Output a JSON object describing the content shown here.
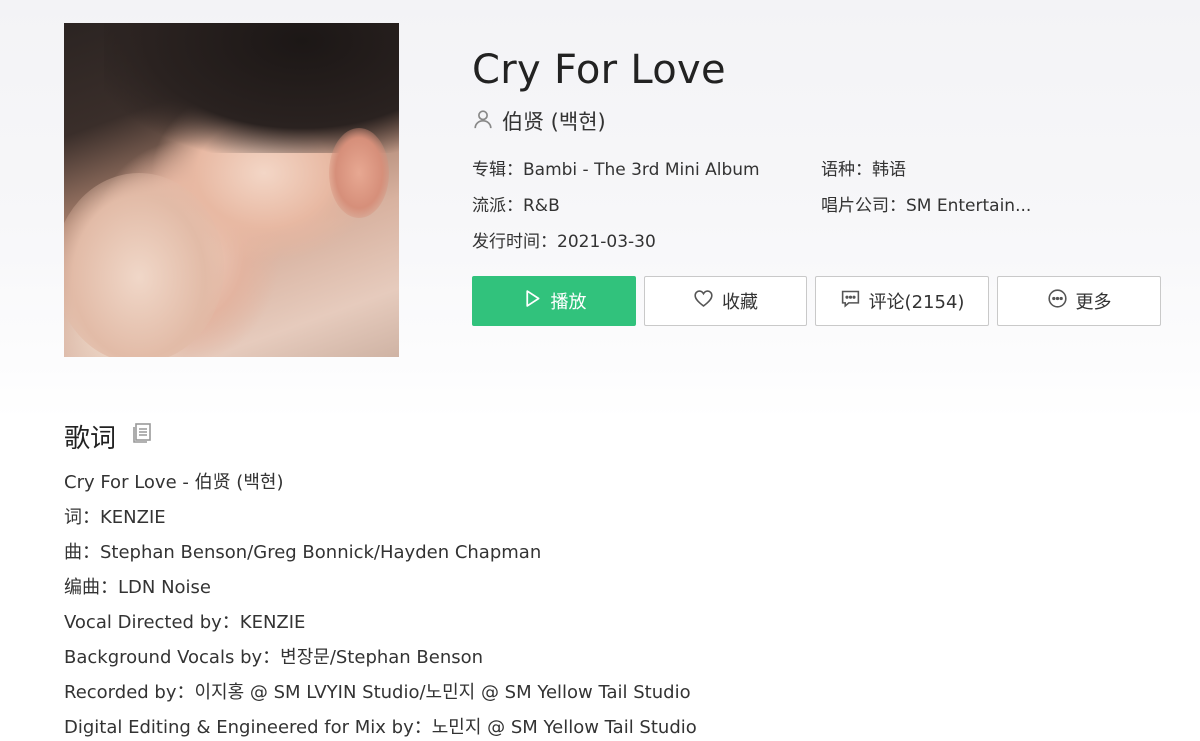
{
  "song": {
    "title": "Cry For Love",
    "artist": "伯贤 (백현)"
  },
  "meta": {
    "album_label": "专辑：",
    "album_value": "Bambi - The 3rd Mini Album",
    "language_label": "语种：",
    "language_value": "韩语",
    "genre_label": "流派：",
    "genre_value": "R&B",
    "label_label": "唱片公司：",
    "label_value": "SM Entertain...",
    "release_label": "发行时间：",
    "release_value": "2021-03-30"
  },
  "actions": {
    "play": "播放",
    "favorite": "收藏",
    "comment": "评论(2154)",
    "more": "更多"
  },
  "lyrics": {
    "heading": "歌词",
    "lines": [
      "Cry For Love - 伯贤 (백현)",
      "词：KENZIE",
      "曲：Stephan Benson/Greg Bonnick/Hayden Chapman",
      "编曲：LDN Noise",
      "Vocal Directed by：KENZIE",
      "Background Vocals by：변장문/Stephan Benson",
      "Recorded by：이지홍 @ SM LVYIN Studio/노민지 @ SM Yellow Tail Studio",
      "Digital Editing & Engineered for Mix by：노민지 @ SM Yellow Tail Studio"
    ]
  },
  "icons": {
    "artist": "user-icon",
    "play": "play-icon",
    "favorite": "heart-icon",
    "comment": "comment-icon",
    "more": "more-icon",
    "copy": "copy-icon"
  },
  "colors": {
    "accent": "#31c27c"
  }
}
